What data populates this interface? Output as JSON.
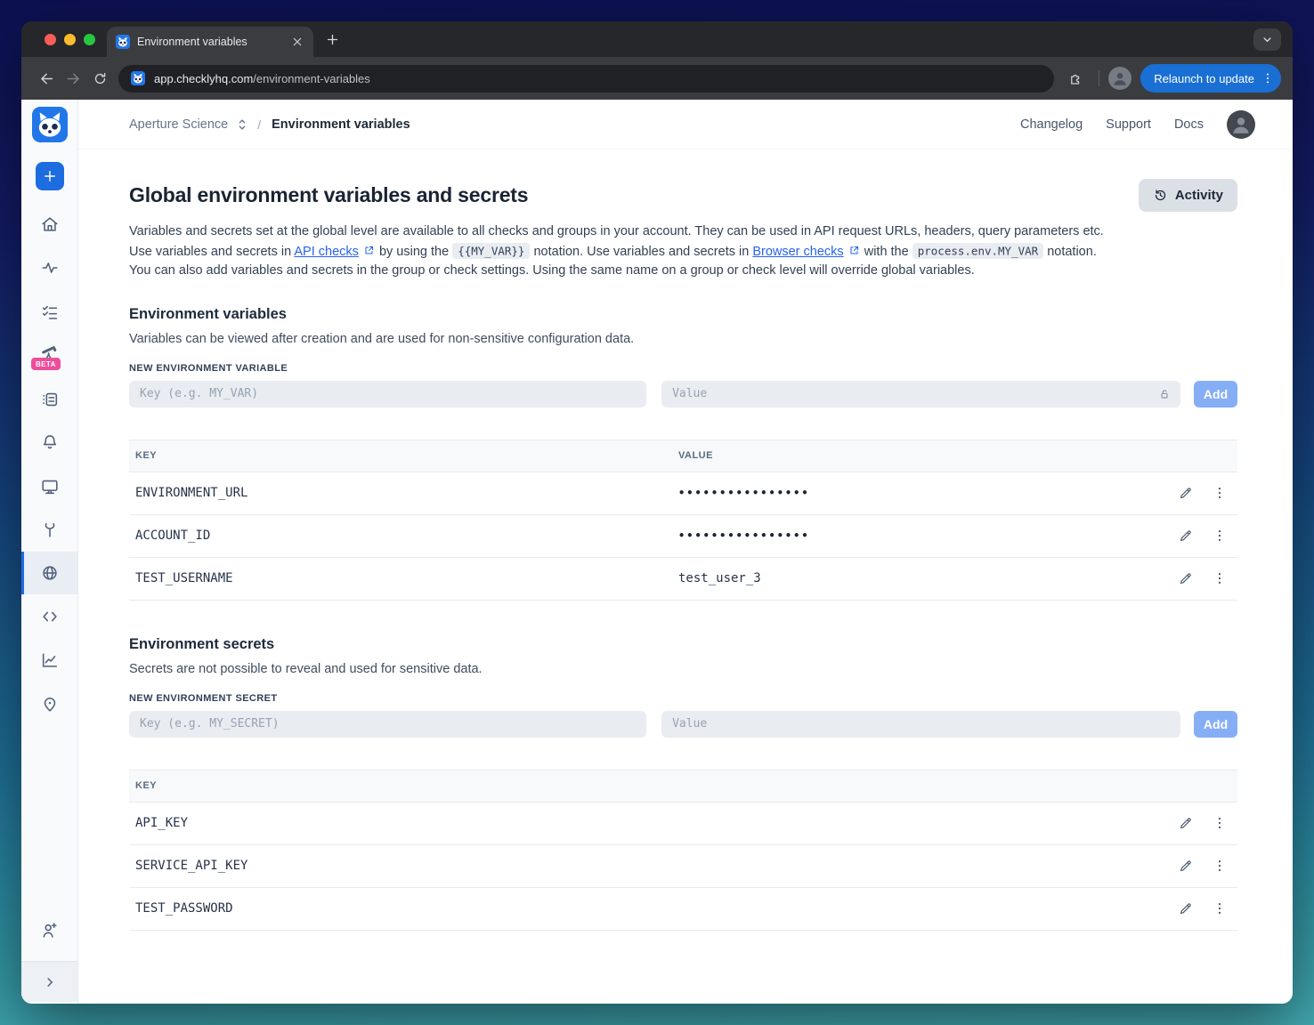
{
  "colors": {
    "brand_blue": "#1d6ce0",
    "link_blue": "#2563eb",
    "beta_pink": "#ee4d9b",
    "add_button_blue": "#86aef5",
    "relaunch_blue": "#1a6fd4",
    "bg_gradient_top": "#0d1050",
    "bg_gradient_bottom": "#43abb2"
  },
  "icons": [
    "raccoon-logo-icon",
    "plus-icon",
    "home-icon",
    "activity-pulse-icon",
    "checklist-icon",
    "telescope-icon",
    "list-details-icon",
    "bell-icon",
    "monitor-icon",
    "tools-icon",
    "globe-icon",
    "code-icon",
    "chart-icon",
    "location-pin-icon",
    "user-plus-icon",
    "collapse-chevron-icon",
    "pencil-icon",
    "kebab-menu-icon",
    "lock-open-icon",
    "external-link-icon",
    "clock-history-icon",
    "extensions-puzzle-icon"
  ],
  "browser": {
    "tab_title": "Environment variables",
    "url_domain": "app.checklyhq.com",
    "url_path": "/environment-variables",
    "relaunch_label": "Relaunch to update"
  },
  "header": {
    "account_name": "Aperture Science",
    "breadcrumb_separator": "/",
    "page_name": "Environment variables",
    "links": {
      "changelog": "Changelog",
      "support": "Support",
      "docs": "Docs"
    }
  },
  "sidebar": {
    "beta_badge": "BETA"
  },
  "main": {
    "title": "Global environment variables and secrets",
    "activity_button": "Activity",
    "intro": {
      "t1": "Variables and secrets set at the global level are available to all checks and groups in your account. They can be used in API request URLs, headers, query parameters etc. Use variables and secrets in ",
      "link_api": "API checks",
      "t2": " by using the ",
      "code_var": "{{MY_VAR}}",
      "t3": " notation. Use variables and secrets in ",
      "link_browser": "Browser checks",
      "t4": " with the ",
      "code_process": "process.env.MY_VAR",
      "t5": " notation. You can also add variables and secrets in the group or check settings. Using the same name on a group or check level will override global variables."
    },
    "variables_section": {
      "heading": "Environment variables",
      "description": "Variables can be viewed after creation and are used for non-sensitive configuration data.",
      "form_label": "NEW ENVIRONMENT VARIABLE",
      "key_placeholder": "Key (e.g. MY_VAR)",
      "value_placeholder": "Value",
      "add_button": "Add",
      "table": {
        "key_header": "KEY",
        "value_header": "VALUE",
        "rows": [
          {
            "key": "ENVIRONMENT_URL",
            "value": "••••••••••••••••"
          },
          {
            "key": "ACCOUNT_ID",
            "value": "••••••••••••••••"
          },
          {
            "key": "TEST_USERNAME",
            "value": "test_user_3"
          }
        ]
      }
    },
    "secrets_section": {
      "heading": "Environment secrets",
      "description": "Secrets are not possible to reveal and used for sensitive data.",
      "form_label": "NEW ENVIRONMENT SECRET",
      "key_placeholder": "Key (e.g. MY_SECRET)",
      "value_placeholder": "Value",
      "add_button": "Add",
      "table": {
        "key_header": "KEY",
        "rows": [
          {
            "key": "API_KEY"
          },
          {
            "key": "SERVICE_API_KEY"
          },
          {
            "key": "TEST_PASSWORD"
          }
        ]
      }
    }
  }
}
